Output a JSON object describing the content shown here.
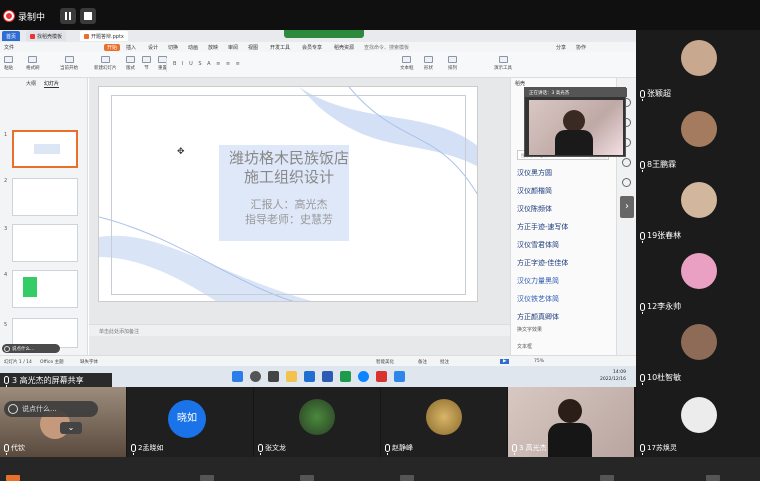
{
  "recording": {
    "label": "录制中"
  },
  "browser": {
    "tabs": [
      {
        "label": "首页"
      },
      {
        "label": "找稻壳模板"
      },
      {
        "label": "开题答辩.pptx"
      }
    ]
  },
  "wps": {
    "menu": [
      "文件",
      "开始",
      "插入",
      "设计",
      "切换",
      "动画",
      "放映",
      "审阅",
      "视图",
      "开发工具",
      "会员专享",
      "稻壳资源"
    ],
    "search_hint": "查找命令、搜索模板",
    "share_labels": [
      "分享",
      "协作"
    ],
    "ribbon": [
      "粘贴",
      "格式刷",
      "当前开始",
      "新建幻灯片",
      "版式",
      "节",
      "重置",
      "文本框",
      "形状",
      "排列",
      "演示工具"
    ],
    "view_tabs": [
      "大纲",
      "幻灯片"
    ],
    "slide_numbers": [
      "1",
      "2",
      "3",
      "4",
      "5"
    ],
    "slide": {
      "title_line1": "潍坊格木民族饭店",
      "title_line2": "施工组织设计",
      "reporter": "汇报人：高光杰",
      "advisor": "指导老师：史慧芳"
    },
    "notes_placeholder": "单击此处添加备注",
    "status": {
      "slide_count": "幻灯片 1 / 14",
      "theme": "Office 主题",
      "font_missing": "缺失字体",
      "smart_beautify": "智能美化",
      "notes": "备注",
      "comments": "批注",
      "zoom": "75%"
    },
    "right_pane": {
      "header": "稻壳",
      "search_placeholder": "搜索字体名称",
      "search_button": "搜索",
      "fonts": [
        "汉仪黑方圆",
        "汉仪颜楷简",
        "汉仪陈频体",
        "方正手迹-速写体",
        "汉仪雪君体简",
        "方正字迹-佳佳体",
        "汉仪力量黑简",
        "汉仪铁艺体简",
        "方正颜真卿体"
      ],
      "more1": "换文字效果",
      "more2": "文本框"
    },
    "presenter_window_title": "正在讲话：3 高光杰"
  },
  "taskbar": {
    "time": "14:09",
    "date": "2022/12/16"
  },
  "subtitle_pill": "说点什么...",
  "share_banner": "3 高光杰的屏幕共享",
  "right_participants": [
    {
      "name": "张颖超",
      "color": "#c9a890"
    },
    {
      "name": "8王鹏霖",
      "color": "#a57b5f"
    },
    {
      "name": "19张春林",
      "color": "#d2b79e"
    },
    {
      "name": "12李永帅",
      "color": "#e9a0c2"
    },
    {
      "name": "10杜智敏",
      "color": "#8e6b56"
    },
    {
      "name": "17苏焕灵",
      "color": "#ececec"
    }
  ],
  "bottom_participants": [
    {
      "name": "代钦"
    },
    {
      "name": "2孟晓如",
      "avatar_text": "晓如"
    },
    {
      "name": "张文龙"
    },
    {
      "name": "赵静峰"
    },
    {
      "name": "3 高光杰"
    }
  ],
  "caption_pill": "说点什么...",
  "colors": {
    "accent_orange": "#e9702a",
    "wps_blue": "#2f6dd5",
    "avatar_blue": "#1a73e8",
    "record_red": "#ee3333"
  }
}
